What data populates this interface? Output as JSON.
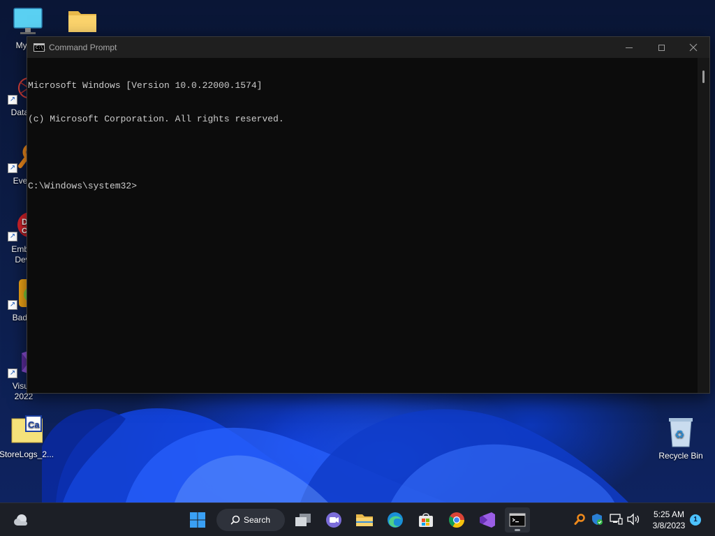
{
  "desktop": {
    "icons": [
      {
        "label": "My Co",
        "icon": "monitor-icon"
      },
      {
        "label": "",
        "icon": "folder-icon"
      },
      {
        "label": "DataW",
        "icon": "datawarrior-icon"
      },
      {
        "label": "Every",
        "icon": "everything-search-icon"
      },
      {
        "label": "Embar",
        "label2": "Dev-",
        "icon": "embarcadero-dev-cpp-icon"
      },
      {
        "label": "Bad P",
        "icon": "bad-piggies-icon"
      },
      {
        "label": "Visual",
        "label2": "2022",
        "icon": "visual-studio-icon"
      },
      {
        "label": "StoreLogs_2...",
        "icon": "storelogs-icon"
      },
      {
        "label": "Recycle Bin",
        "icon": "recycle-bin-icon"
      }
    ]
  },
  "window": {
    "title": "Command Prompt",
    "lines": [
      "Microsoft Windows [Version 10.0.22000.1574]",
      "(c) Microsoft Corporation. All rights reserved.",
      "",
      "C:\\Windows\\system32>"
    ],
    "icon_text": "C:\\_"
  },
  "taskbar": {
    "search_label": "Search",
    "apps": [
      "task-view-icon",
      "teams-icon",
      "file-explorer-icon",
      "edge-icon",
      "store-icon",
      "chrome-icon",
      "visual-studio-icon",
      "command-prompt-icon"
    ],
    "time": "5:25 AM",
    "date": "3/8/2023",
    "notification_count": "1"
  },
  "colors": {
    "console_bg": "#0c0c0c",
    "console_text": "#cccccc",
    "titlebar_bg": "#1f1f1f",
    "taskbar_bg": "#1c1f26",
    "accent": "#4cc2ff"
  }
}
